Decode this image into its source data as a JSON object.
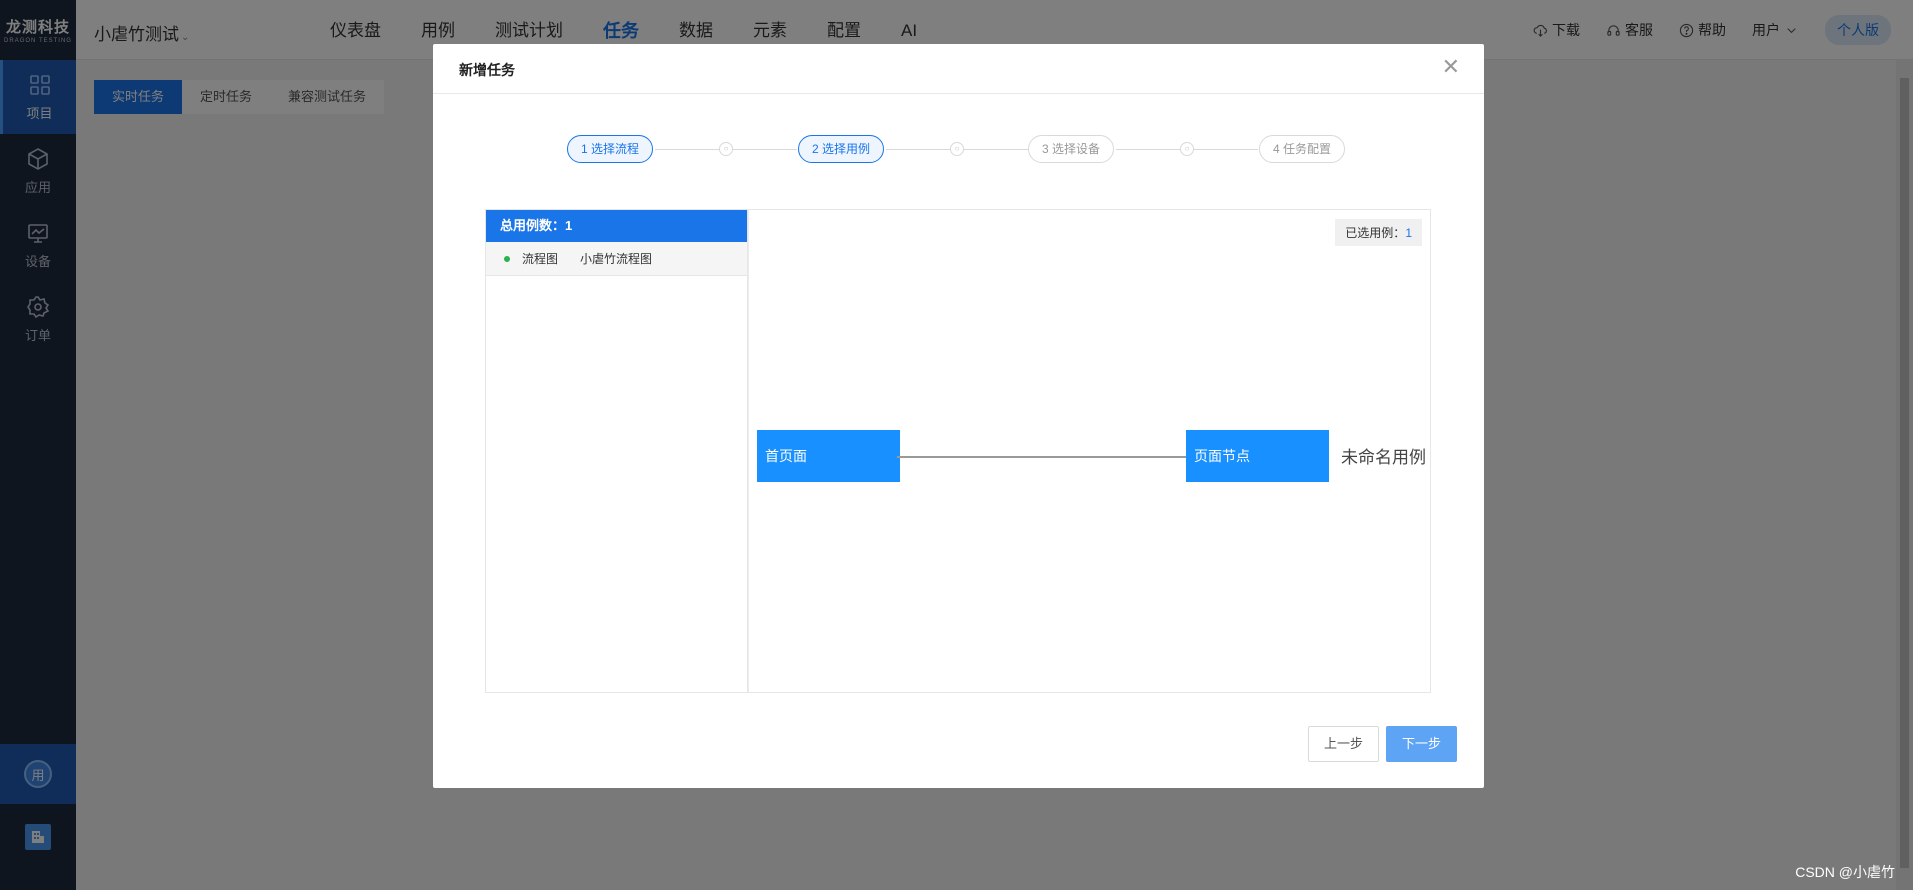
{
  "sidebar": {
    "logo_cn": "龙测科技",
    "logo_en": "DRAGON TESTING",
    "items": [
      {
        "label": "项目",
        "icon": "grid-icon"
      },
      {
        "label": "应用",
        "icon": "cube-icon"
      },
      {
        "label": "设备",
        "icon": "monitor-icon"
      },
      {
        "label": "订单",
        "icon": "gear-icon"
      }
    ],
    "avatar_text": "用"
  },
  "topbar": {
    "project_name": "小虐竹测试",
    "nav": [
      "仪表盘",
      "用例",
      "测试计划",
      "任务",
      "数据",
      "元素",
      "配置",
      "AI"
    ],
    "active_nav": "任务",
    "download": "下载",
    "service": "客服",
    "help": "帮助",
    "user": "用户",
    "personal": "个人版"
  },
  "subtabs": [
    "实时任务",
    "定时任务",
    "兼容测试任务"
  ],
  "modal": {
    "title": "新增任务",
    "steps": [
      "1 选择流程",
      "2 选择用例",
      "3 选择设备",
      "4 任务配置"
    ],
    "step_dot": "○",
    "left_header_label": "总用例数：",
    "left_header_count": "1",
    "cases": [
      {
        "type": "流程图",
        "name": "小虐竹流程图"
      }
    ],
    "selected_label": "已选用例：",
    "selected_count": "1",
    "flow_nodes": [
      "首页面",
      "页面节点"
    ],
    "flow_case_label": "未命名用例",
    "prev_button": "上一步",
    "next_button": "下一步"
  },
  "watermark": "CSDN @小虐竹",
  "colors": {
    "accent": "#1a75e8",
    "sidebar": "#1f2a3c",
    "node": "#1890ff",
    "next_button": "#5da4f5"
  }
}
